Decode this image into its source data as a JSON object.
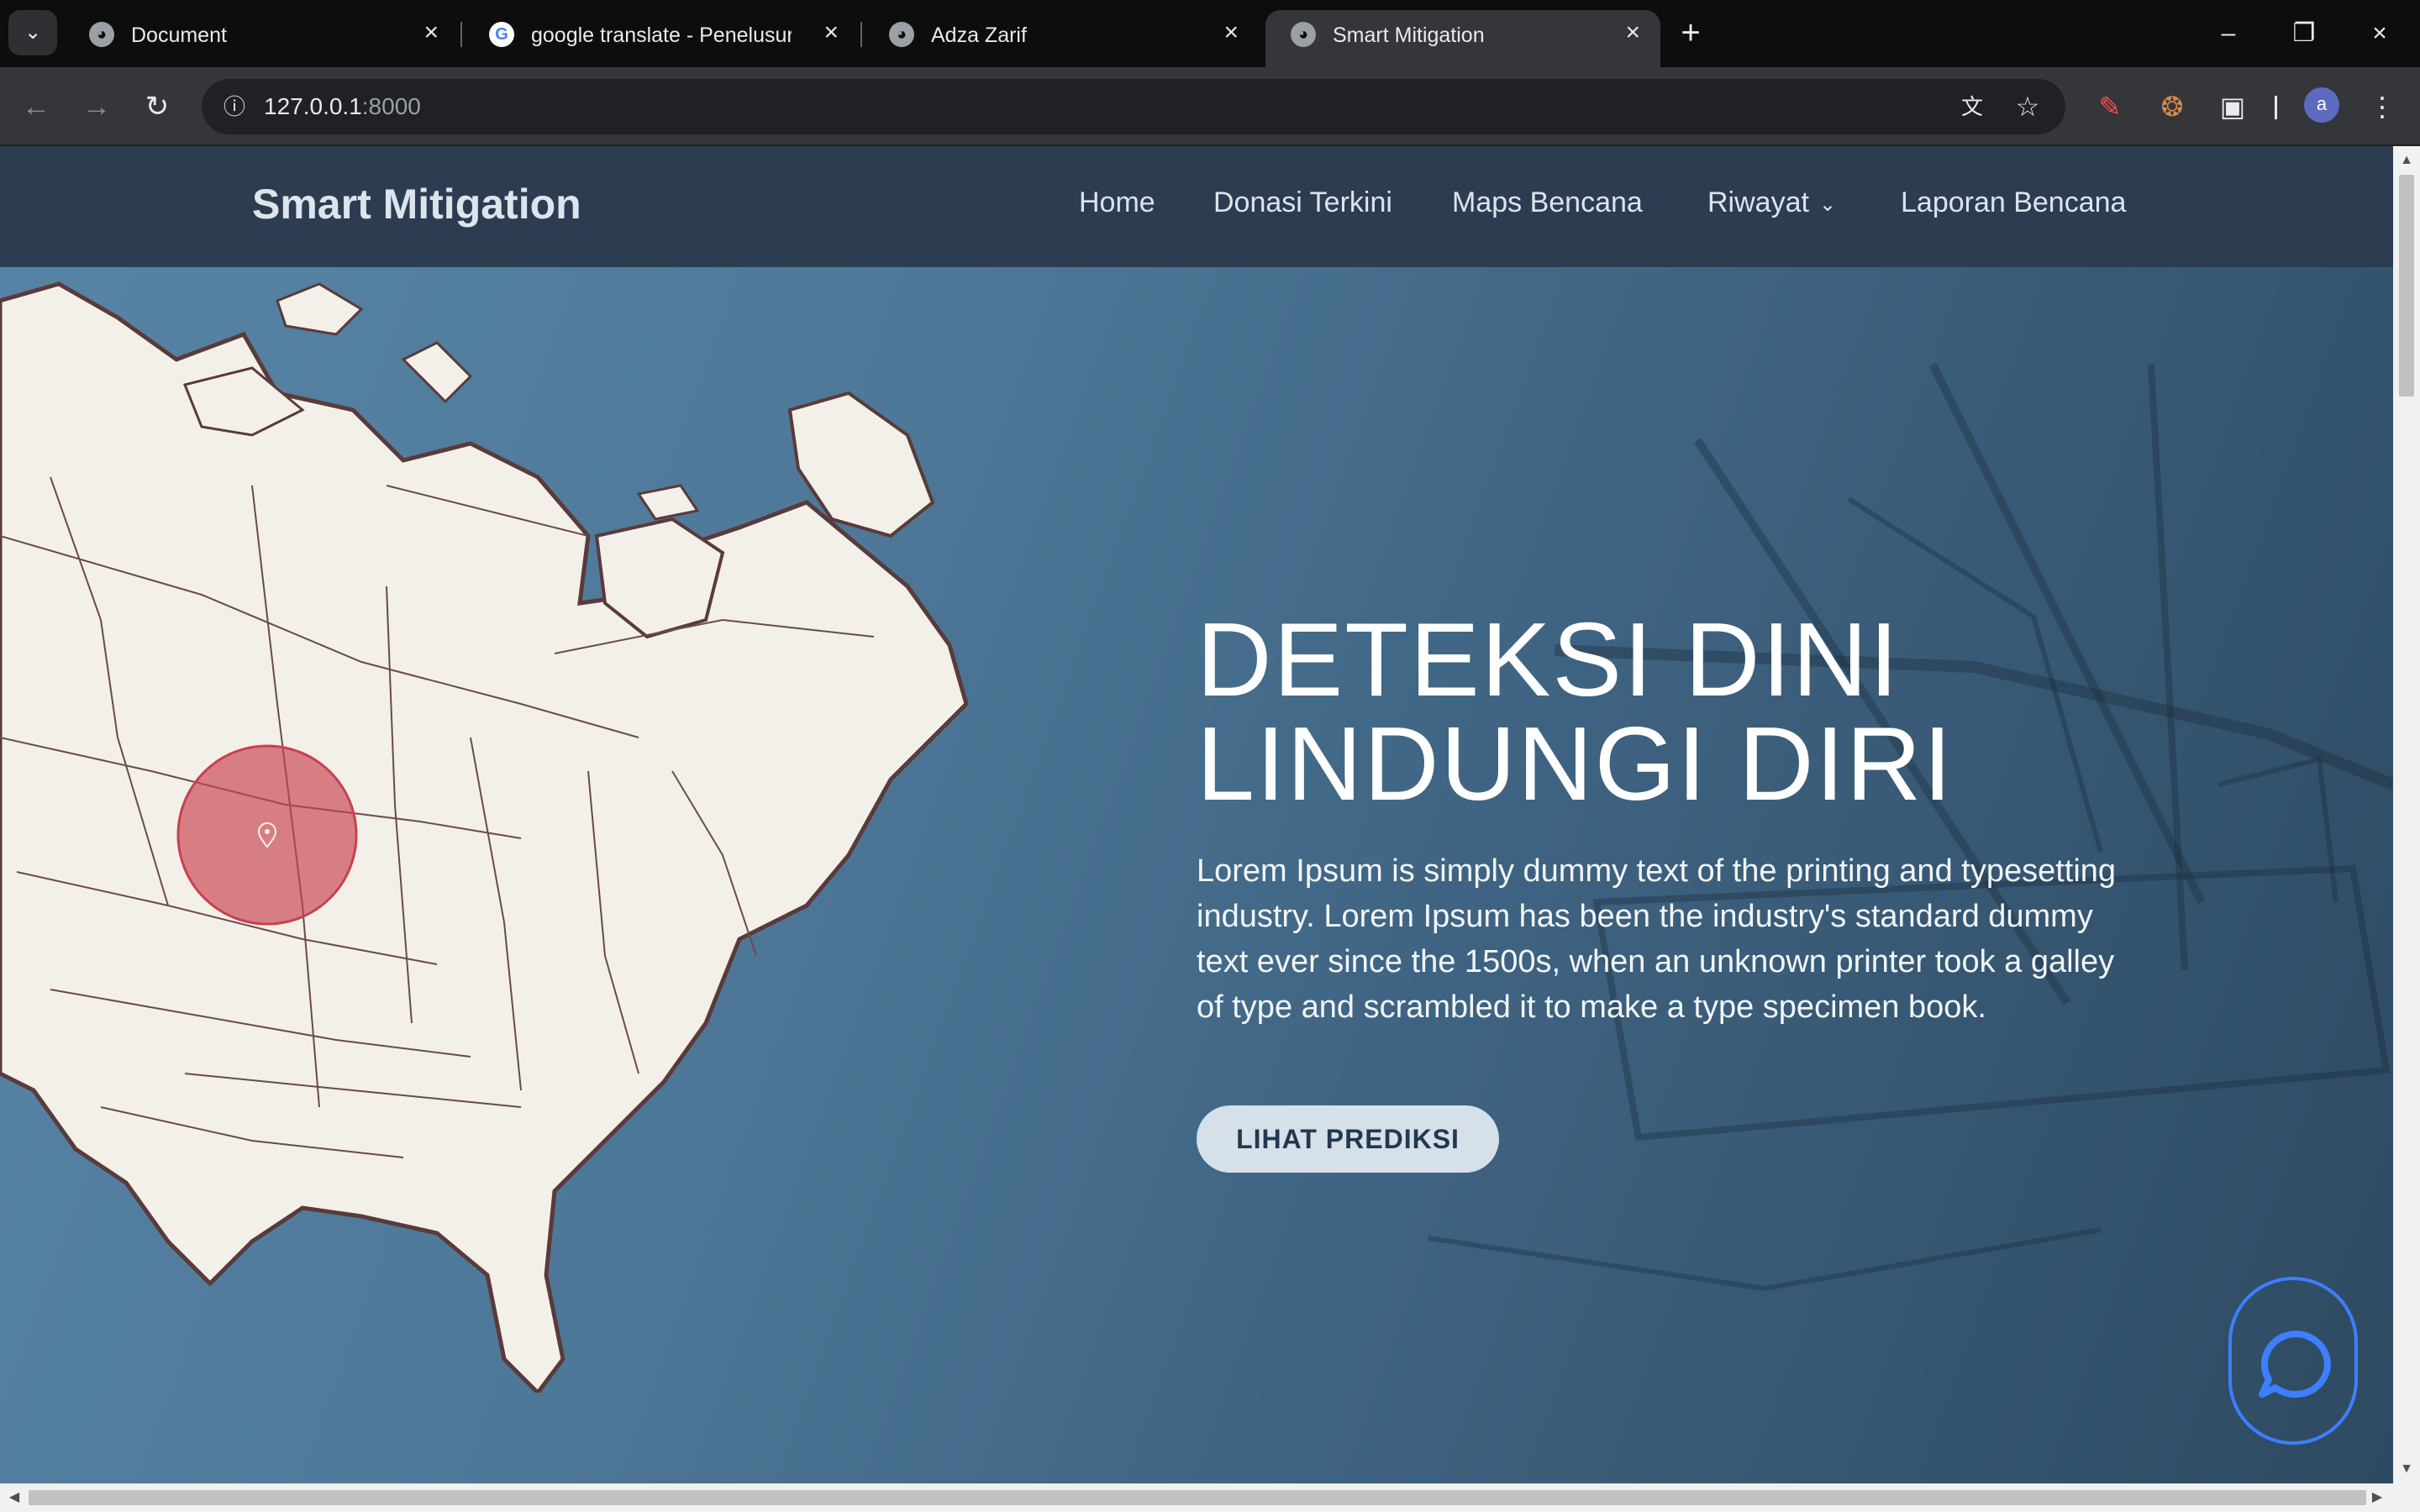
{
  "browser": {
    "tabs": [
      {
        "title": "Document",
        "active": false
      },
      {
        "title": "google translate - Penelusuran Google",
        "active": false
      },
      {
        "title": "Adza Zarif",
        "active": false
      },
      {
        "title": "Smart Mitigation",
        "active": true
      }
    ],
    "url_host": "127.0.0.1",
    "url_port": ":8000",
    "profile_initial": "a"
  },
  "site": {
    "brand": "Smart Mitigation",
    "menu": [
      "Home",
      "Donasi Terkini",
      "Maps Bencana",
      "Riwayat",
      "Laporan Bencana"
    ],
    "hero": {
      "title_line1": "DETEKSI DINI",
      "title_line2": "LINDUNGI DIRI",
      "description": "Lorem Ipsum is simply dummy text of the printing and typesetting industry. Lorem Ipsum has been the industry's standard dummy text ever since the 1500s, when an unknown printer took a galley of type and scrambled it to make a type specimen book.",
      "cta_label": "LIHAT PREDIKSI"
    }
  },
  "colors": {
    "navbar": "#2c3d51",
    "hero_start": "#5784a6",
    "hero_end": "#2e4a61",
    "cta_bg": "#d6e0e9",
    "chat_border": "#3d7fff",
    "marker": "#c8414e"
  },
  "icons": [
    "tab-search-icon",
    "globe-icon",
    "google-icon",
    "close-icon",
    "plus-icon",
    "minimize-icon",
    "restore-icon",
    "back-icon",
    "forward-icon",
    "reload-icon",
    "site-info-icon",
    "translate-icon",
    "star-icon",
    "extension-icon",
    "cookie-icon",
    "puzzle-icon",
    "menu-icon",
    "location-pin-icon",
    "chat-icon"
  ]
}
